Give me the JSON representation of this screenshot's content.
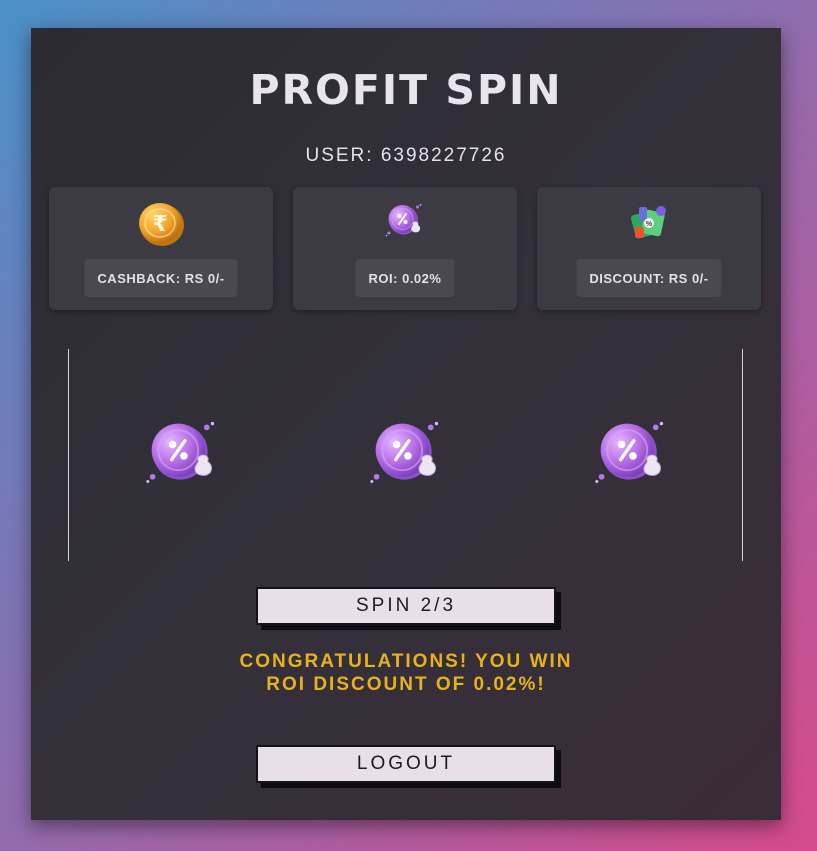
{
  "app": {
    "title": "PROFIT SPIN"
  },
  "user": {
    "label": "USER: 6398227726"
  },
  "stats": [
    {
      "icon": "rupee-coin-icon",
      "label": "CASHBACK: RS 0/-"
    },
    {
      "icon": "percent-coin-icon",
      "label": "ROI: 0.02%"
    },
    {
      "icon": "discount-gift-icon",
      "label": "DISCOUNT: RS 0/-"
    }
  ],
  "reels": [
    {
      "icon": "percent-coin-icon"
    },
    {
      "icon": "percent-coin-icon"
    },
    {
      "icon": "percent-coin-icon"
    }
  ],
  "spin_button": {
    "label": "SPIN 2/3"
  },
  "result": {
    "line1": "CONGRATULATIONS! YOU WIN",
    "line2": "ROI DISCOUNT OF 0.02%!"
  },
  "logout_button": {
    "label": "LOGOUT"
  },
  "colors": {
    "accent": "#e8b21c",
    "button_bg": "#e8dfe8",
    "card_bg": "#2e2c34"
  }
}
